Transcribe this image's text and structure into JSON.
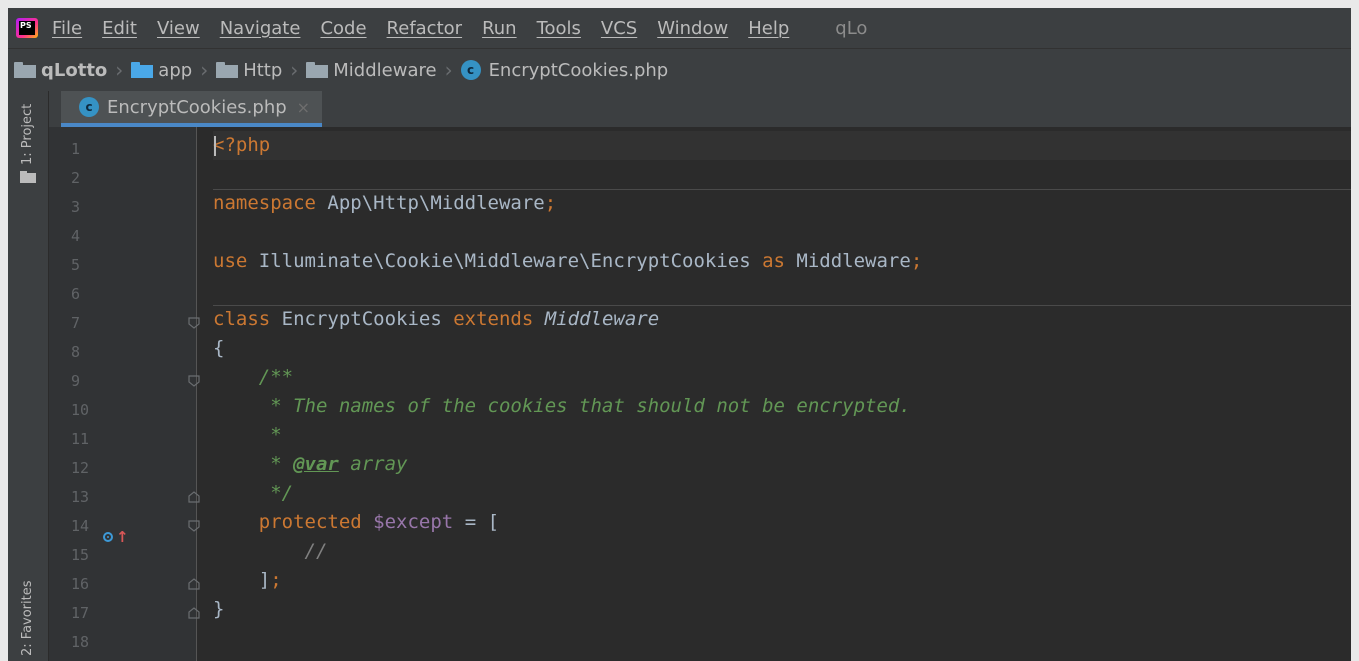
{
  "menubar": {
    "app_icon": "phpstorm-logo",
    "app_icon_text": "PS",
    "items": [
      "File",
      "Edit",
      "View",
      "Navigate",
      "Code",
      "Refactor",
      "Run",
      "Tools",
      "VCS",
      "Window",
      "Help"
    ],
    "project_title_fragment": "qLo"
  },
  "breadcrumb": {
    "items": [
      {
        "label": "qLotto",
        "icon": "folder-icon"
      },
      {
        "label": "app",
        "icon": "folder-icon"
      },
      {
        "label": "Http",
        "icon": "folder-icon"
      },
      {
        "label": "Middleware",
        "icon": "folder-icon"
      },
      {
        "label": "EncryptCookies.php",
        "icon": "php-class-icon",
        "icon_text": "c"
      }
    ]
  },
  "tool_stripe": {
    "project_label": "1: Project",
    "favorites_label": "2: Favorites"
  },
  "tab": {
    "label": "EncryptCookies.php",
    "icon_text": "c",
    "close": "×"
  },
  "editor": {
    "line_numbers": [
      "1",
      "2",
      "3",
      "4",
      "5",
      "6",
      "7",
      "8",
      "9",
      "10",
      "11",
      "12",
      "13",
      "14",
      "15",
      "16",
      "17",
      "18"
    ],
    "lines": [
      "<?php",
      "",
      "namespace App\\Http\\Middleware;",
      "",
      "use Illuminate\\Cookie\\Middleware\\EncryptCookies as Middleware;",
      "",
      "class EncryptCookies extends Middleware",
      "{",
      "    /**",
      "     * The names of the cookies that should not be encrypted.",
      "     *",
      "     * @var array",
      "     */",
      "    protected $except = [",
      "        //",
      "    ];",
      "}",
      ""
    ],
    "override_marker_line": "14"
  },
  "colors": {
    "background": "#2b2b2b",
    "keyword": "#cc7832",
    "doc_comment": "#629755",
    "variable": "#9876aa",
    "text": "#a9b7c6",
    "accent": "#4a88c7"
  }
}
